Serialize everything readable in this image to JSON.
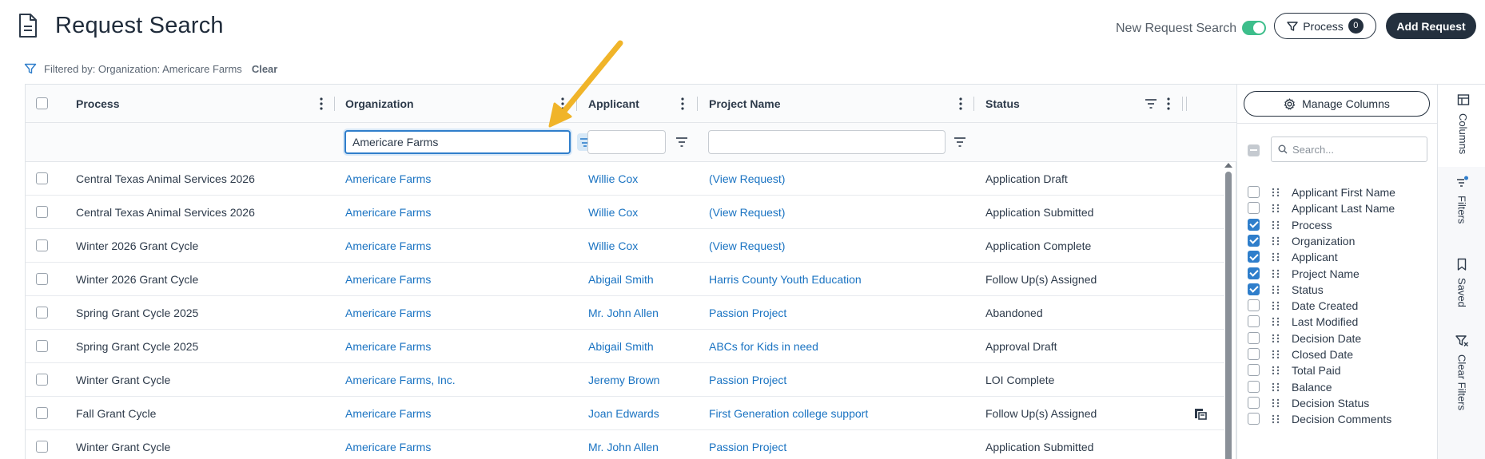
{
  "header": {
    "title": "Request Search",
    "toggle_label": "New Request Search",
    "toggle_on": true,
    "process_button_label": "Process",
    "process_count": "0",
    "add_button_label": "Add Request"
  },
  "filter_bar": {
    "text": "Filtered by: Organization: Americare Farms",
    "clear_label": "Clear"
  },
  "grid": {
    "columns": [
      "Process",
      "Organization",
      "Applicant",
      "Project Name",
      "Status"
    ],
    "filters": {
      "organization_value": "Americare Farms",
      "applicant_value": "",
      "project_value": ""
    },
    "rows": [
      {
        "process": "Central Texas Animal Services 2026",
        "organization": "Americare Farms",
        "applicant": "Willie Cox",
        "project": "(View Request)",
        "status": "Application Draft"
      },
      {
        "process": "Central Texas Animal Services 2026",
        "organization": "Americare Farms",
        "applicant": "Willie Cox",
        "project": "(View Request)",
        "status": "Application Submitted"
      },
      {
        "process": "Winter 2026 Grant Cycle",
        "organization": "Americare Farms",
        "applicant": "Willie Cox",
        "project": "(View Request)",
        "status": "Application Complete"
      },
      {
        "process": "Winter 2026 Grant Cycle",
        "organization": "Americare Farms",
        "applicant": "Abigail Smith",
        "project": "Harris County Youth Education",
        "status": "Follow Up(s) Assigned"
      },
      {
        "process": "Spring Grant Cycle 2025",
        "organization": "Americare Farms",
        "applicant": "Mr. John Allen",
        "project": "Passion Project",
        "status": "Abandoned"
      },
      {
        "process": "Spring Grant Cycle 2025",
        "organization": "Americare Farms",
        "applicant": "Abigail Smith",
        "project": "ABCs for Kids in need",
        "status": "Approval Draft"
      },
      {
        "process": "Winter Grant Cycle",
        "organization": "Americare Farms, Inc.",
        "applicant": "Jeremy Brown",
        "project": "Passion Project",
        "status": "LOI Complete"
      },
      {
        "process": "Fall Grant Cycle",
        "organization": "Americare Farms",
        "applicant": "Joan Edwards",
        "project": "First Generation college support",
        "status": "Follow Up(s) Assigned"
      },
      {
        "process": "Winter Grant Cycle",
        "organization": "Americare Farms",
        "applicant": "Mr. John Allen",
        "project": "Passion Project",
        "status": "Application Submitted"
      }
    ]
  },
  "column_panel": {
    "manage_label": "Manage Columns",
    "search_placeholder": "Search...",
    "items": [
      {
        "label": "Applicant First Name",
        "checked": false
      },
      {
        "label": "Applicant Last Name",
        "checked": false
      },
      {
        "label": "Process",
        "checked": true
      },
      {
        "label": "Organization",
        "checked": true
      },
      {
        "label": "Applicant",
        "checked": true
      },
      {
        "label": "Project Name",
        "checked": true
      },
      {
        "label": "Status",
        "checked": true
      },
      {
        "label": "Date Created",
        "checked": false
      },
      {
        "label": "Last Modified",
        "checked": false
      },
      {
        "label": "Decision Date",
        "checked": false
      },
      {
        "label": "Closed Date",
        "checked": false
      },
      {
        "label": "Total Paid",
        "checked": false
      },
      {
        "label": "Balance",
        "checked": false
      },
      {
        "label": "Decision Status",
        "checked": false
      },
      {
        "label": "Decision Comments",
        "checked": false
      }
    ]
  },
  "side_tabs": [
    "Columns",
    "Filters",
    "Saved",
    "Clear Filters"
  ],
  "colors": {
    "accent": "#2f7ecb",
    "link": "#1a73c2",
    "toggle": "#3dbe8b",
    "dark_button": "#24303e",
    "annotation_arrow": "#f0b429"
  }
}
